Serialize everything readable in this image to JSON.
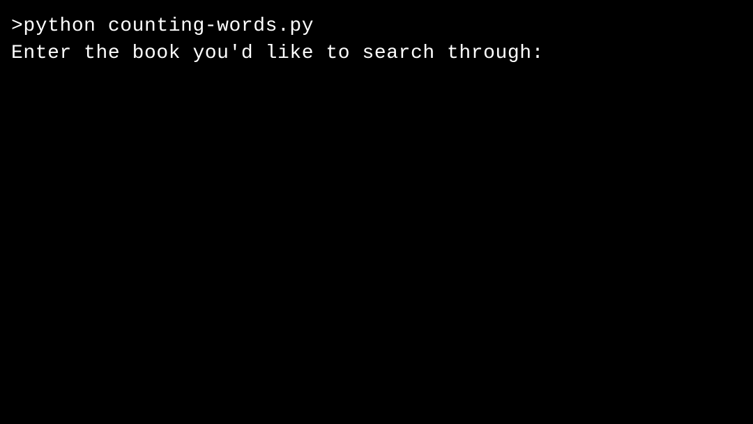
{
  "terminal": {
    "line1": ">python counting-words.py",
    "line2": "Enter the book you'd like to search through:"
  }
}
